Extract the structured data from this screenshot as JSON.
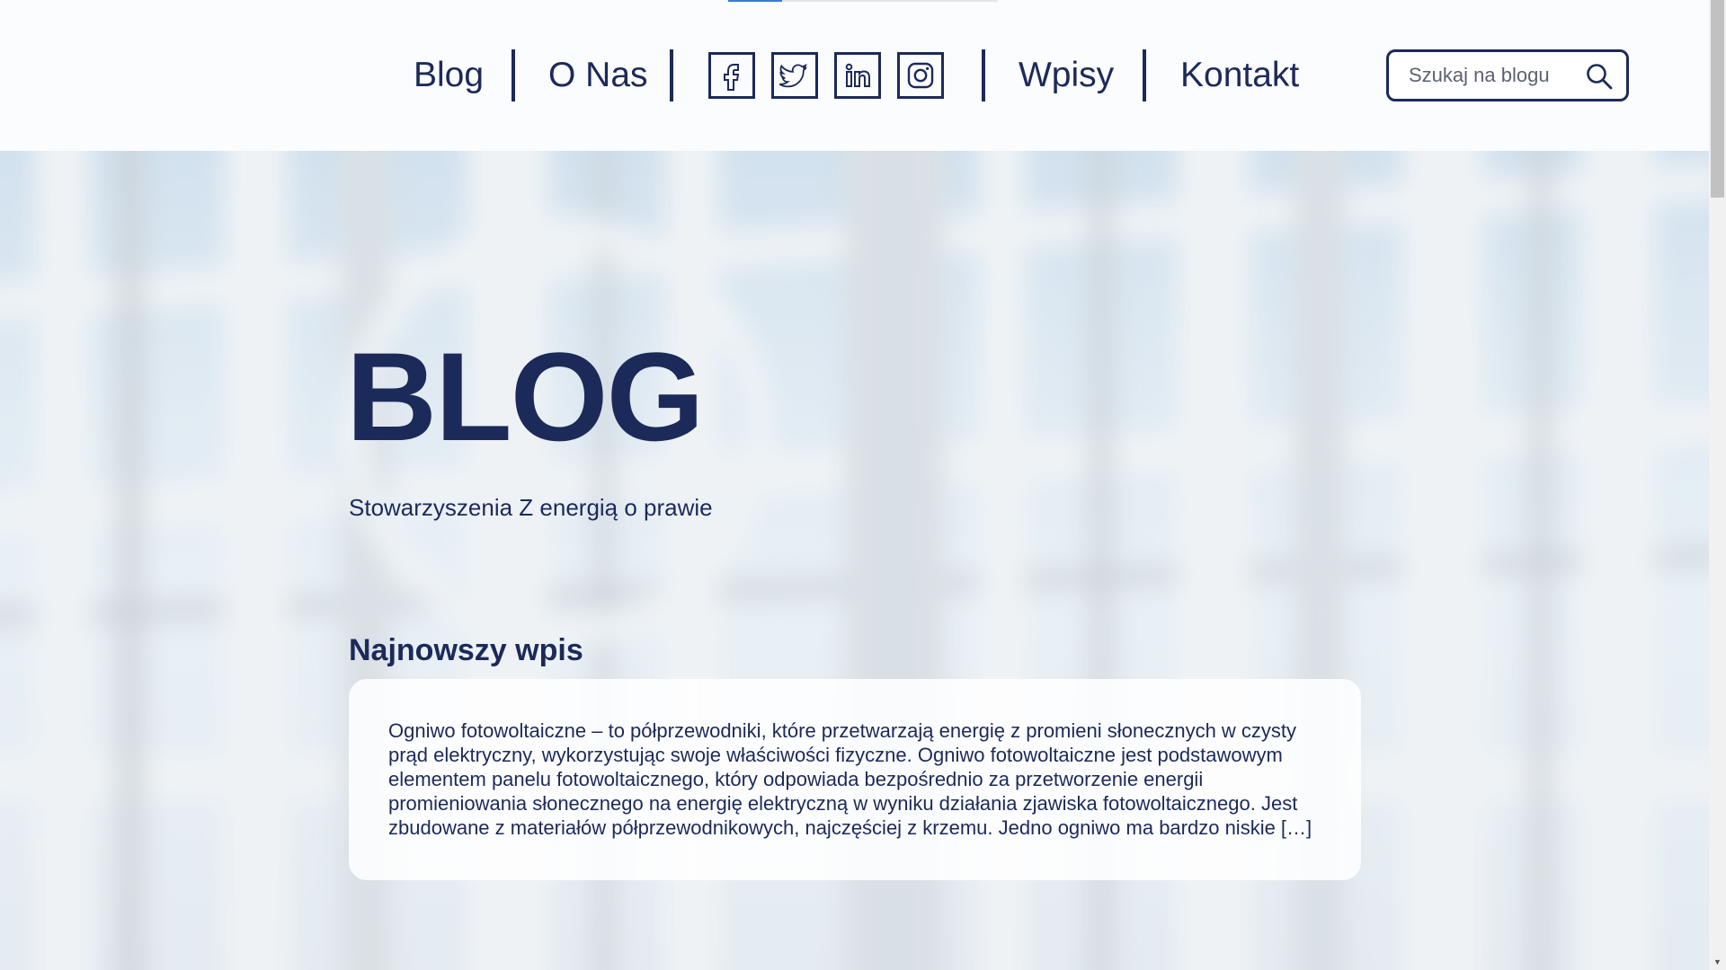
{
  "nav": {
    "items": [
      {
        "label": "Blog"
      },
      {
        "label": "O Nas"
      },
      {
        "label": "Wpisy"
      },
      {
        "label": "Kontakt"
      }
    ],
    "social": [
      {
        "icon": "facebook-icon"
      },
      {
        "icon": "twitter-icon"
      },
      {
        "icon": "linkedin-icon"
      },
      {
        "icon": "instagram-icon"
      }
    ]
  },
  "search": {
    "placeholder": "Szukaj na blogu",
    "value": "",
    "icon": "search-icon"
  },
  "hero": {
    "title": "BLOG",
    "subtitle": "Stowarzyszenia Z energią o prawie"
  },
  "latest": {
    "heading": "Najnowszy wpis",
    "excerpt": "Ogniwo fotowoltaiczne – to półprzewodniki, które przetwarzają energię z promieni słonecznych w czysty prąd elektryczny, wykorzystując swoje właściwości fizyczne. Ogniwo fotowoltaiczne jest podstawowym elementem panelu fotowoltaicznego, który odpowiada bezpośrednio za przetworzenie energii promieniowania słonecznego na energię elektryczną w wyniku działania zjawiska fotowoltaicznego. Jest zbudowane z materiałów półprzewodnikowych, najczęściej z krzemu. Jedno ogniwo ma bardzo niskie […]"
  },
  "colors": {
    "primary": "#1c2a5a",
    "header_bg": "#fbfcfd",
    "card_bg": "#ffffff"
  }
}
